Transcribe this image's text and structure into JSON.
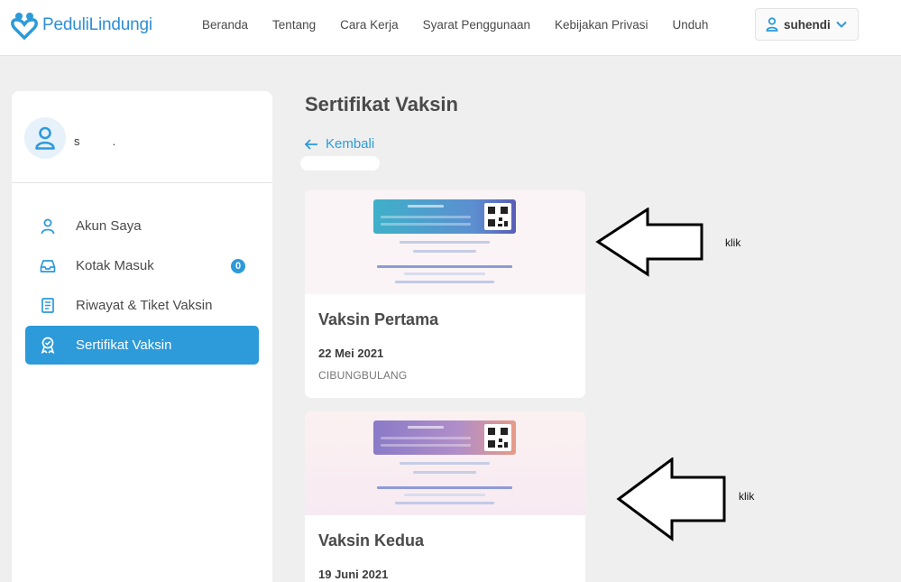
{
  "header": {
    "brand": "PeduliLindungi",
    "nav": [
      "Beranda",
      "Tentang",
      "Cara Kerja",
      "Syarat Penggunaan",
      "Kebijakan Privasi",
      "Unduh"
    ],
    "user": "suhendi"
  },
  "sidebar": {
    "profile_name": "s          .",
    "items": [
      {
        "label": "Akun Saya",
        "icon": "person-icon"
      },
      {
        "label": "Kotak Masuk",
        "icon": "inbox-icon",
        "badge": "0"
      },
      {
        "label": "Riwayat & Tiket Vaksin",
        "icon": "document-icon"
      },
      {
        "label": "Sertifikat Vaksin",
        "icon": "award-icon",
        "active": true
      }
    ]
  },
  "main": {
    "title": "Sertifikat Vaksin",
    "back": "Kembali",
    "cards": [
      {
        "name": "Vaksin Pertama",
        "date": "22 Mei 2021",
        "location": "CIBUNGBULANG"
      },
      {
        "name": "Vaksin Kedua",
        "date": "19 Juni 2021",
        "location": ""
      }
    ]
  },
  "annotations": {
    "arrow1_label": "klik",
    "arrow2_label": "klik"
  },
  "colors": {
    "brand": "#2d9ad9",
    "active_bg": "#2d9ad9",
    "page_bg": "#efefef"
  }
}
